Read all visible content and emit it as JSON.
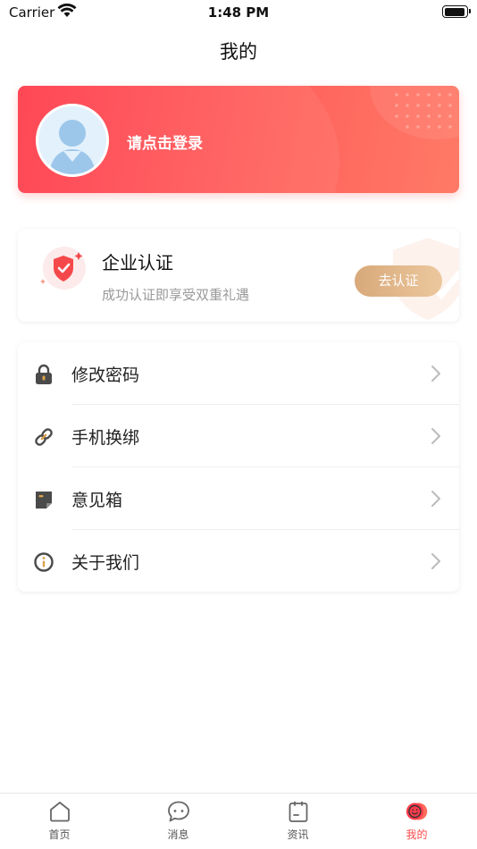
{
  "status_bar": {
    "carrier": "Carrier",
    "time": "1:48 PM"
  },
  "nav": {
    "title": "我的"
  },
  "profile": {
    "login_text": "请点击登录"
  },
  "certification": {
    "title": "企业认证",
    "subtitle": "成功认证即享受双重礼遇",
    "button_label": "去认证"
  },
  "menu": {
    "items": [
      {
        "label": "修改密码",
        "icon": "lock-icon"
      },
      {
        "label": "手机换绑",
        "icon": "link-icon"
      },
      {
        "label": "意见箱",
        "icon": "note-icon"
      },
      {
        "label": "关于我们",
        "icon": "info-icon"
      }
    ]
  },
  "tabbar": {
    "tabs": [
      {
        "label": "首页",
        "icon": "home-icon",
        "active": false
      },
      {
        "label": "消息",
        "icon": "chat-icon",
        "active": false
      },
      {
        "label": "资讯",
        "icon": "news-icon",
        "active": false
      },
      {
        "label": "我的",
        "icon": "profile-icon",
        "active": true
      }
    ]
  },
  "colors": {
    "accent": "#ff4a4a",
    "profile_gradient_start": "#ff3c4c",
    "profile_gradient_end": "#ff7a66",
    "cert_button": "#dfb287",
    "icon_gold": "#d9a04a",
    "icon_dark": "#4a4a4a"
  }
}
